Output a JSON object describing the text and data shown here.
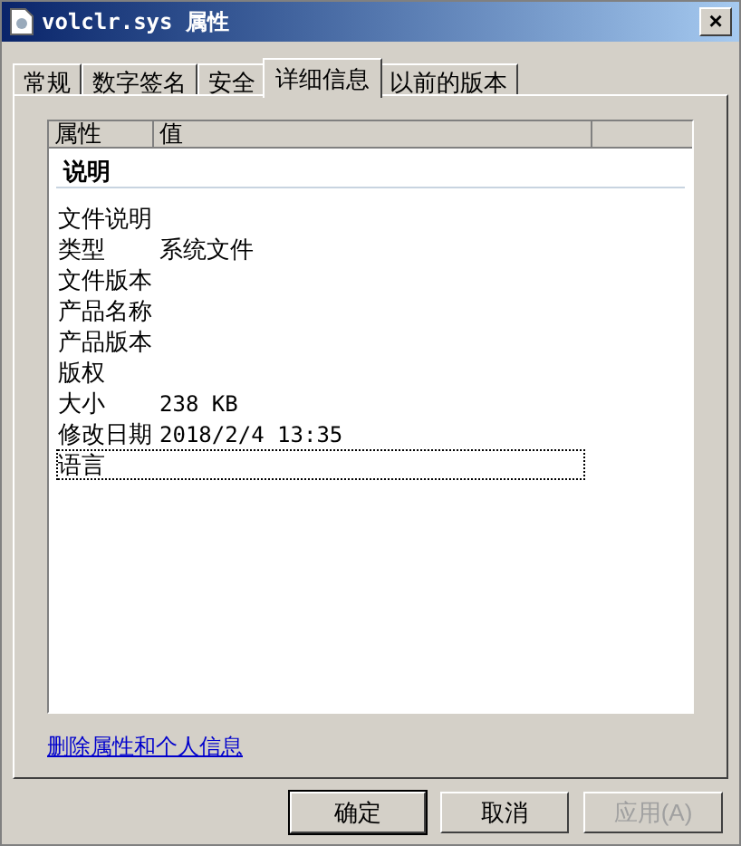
{
  "window": {
    "title": "volclr.sys 属性",
    "close": "×"
  },
  "tabs": [
    {
      "label": "常规",
      "selected": false
    },
    {
      "label": "数字签名",
      "selected": false
    },
    {
      "label": "安全",
      "selected": false
    },
    {
      "label": "详细信息",
      "selected": true
    },
    {
      "label": "以前的版本",
      "selected": false
    }
  ],
  "details": {
    "columns": [
      "属性",
      "值"
    ],
    "group": "说明",
    "rows": [
      {
        "property": "文件说明",
        "focused": false
      },
      {
        "property": "类型",
        "value": "系统文件",
        "focused": false
      },
      {
        "property": "文件版本",
        "focused": false
      },
      {
        "property": "产品名称",
        "focused": false
      },
      {
        "property": "产品版本",
        "focused": false
      },
      {
        "property": "版权",
        "focused": false
      },
      {
        "property": "大小",
        "value": "238 KB",
        "focused": false
      },
      {
        "property": "修改日期",
        "value": "2018/2/4 13:35",
        "focused": false
      },
      {
        "property": "语言",
        "focused": true
      }
    ]
  },
  "link": "删除属性和个人信息",
  "buttons": [
    {
      "label": "确定",
      "default": true,
      "disabled": false
    },
    {
      "label": "取消",
      "default": false,
      "disabled": false
    },
    {
      "label": "应用(A)",
      "default": false,
      "disabled": true
    }
  ]
}
